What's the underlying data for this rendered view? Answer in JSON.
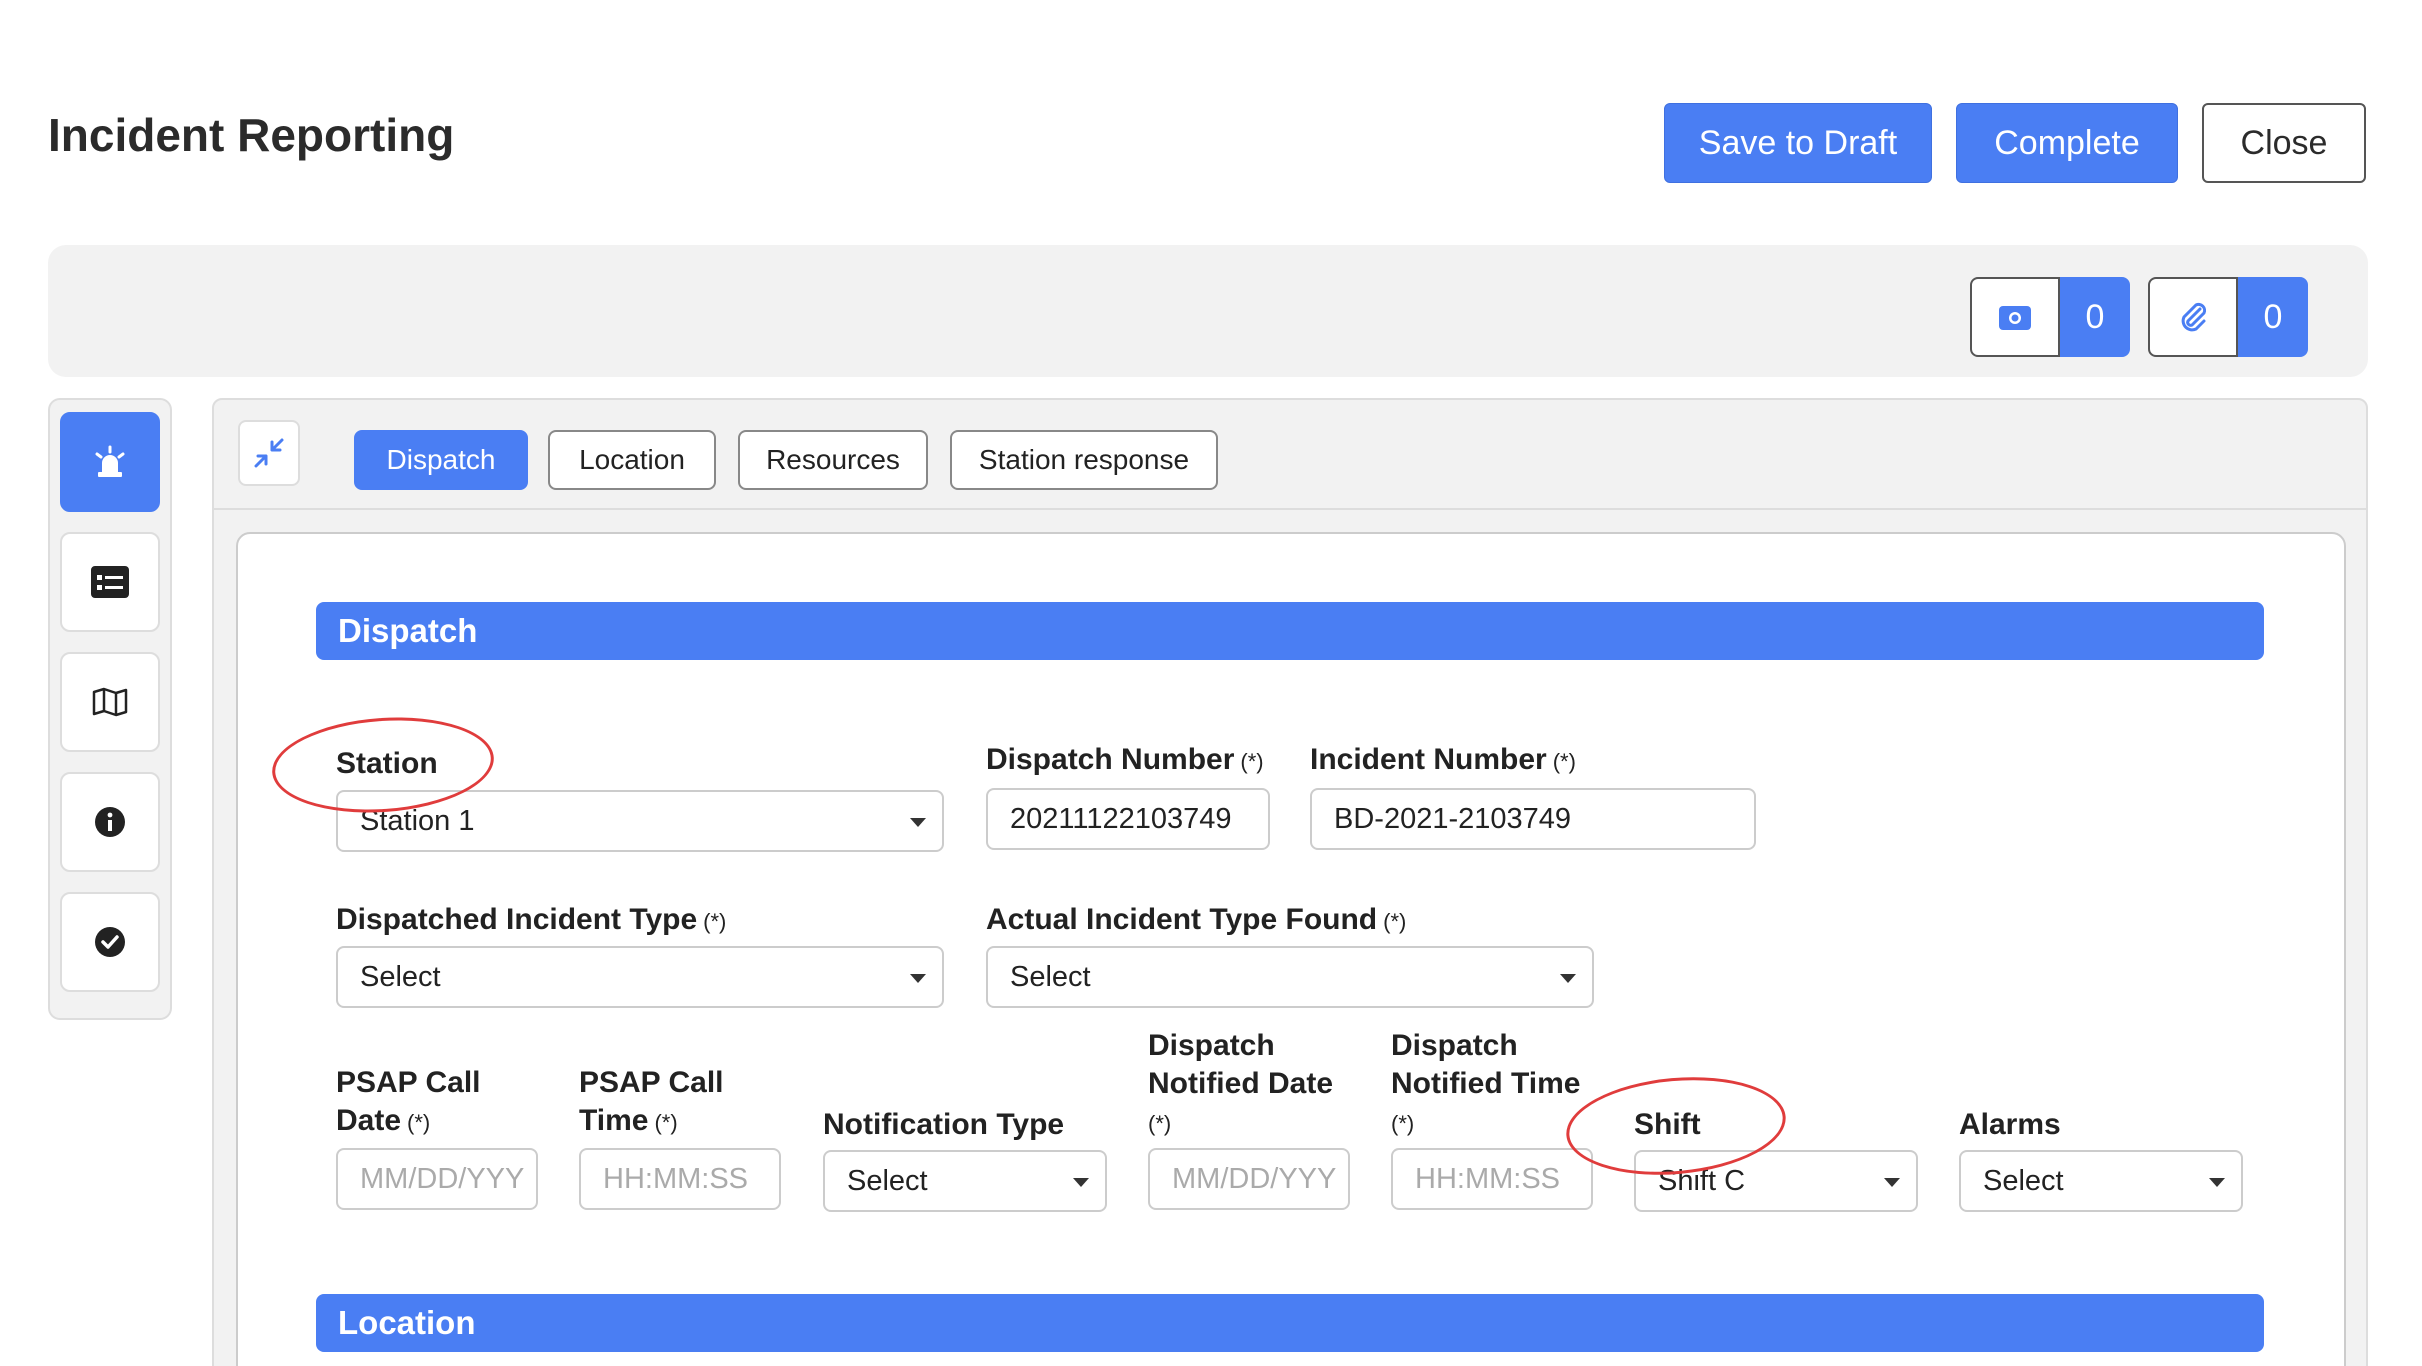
{
  "page": {
    "title": "Incident Reporting"
  },
  "actions": {
    "save_draft": "Save to Draft",
    "complete": "Complete",
    "close": "Close"
  },
  "toolbar": {
    "photos_count": "0",
    "attachments_count": "0"
  },
  "sidebar": {
    "items": [
      "siren-icon",
      "form-card-icon",
      "map-icon",
      "info-icon",
      "check-circle-icon"
    ],
    "active_index": 0
  },
  "tabs": [
    "Dispatch",
    "Location",
    "Resources",
    "Station response"
  ],
  "active_tab": "Dispatch",
  "sections": {
    "dispatch": "Dispatch",
    "location": "Location"
  },
  "form": {
    "required_mark": "(*)",
    "station": {
      "label": "Station",
      "value": "Station 1"
    },
    "dispatch_number": {
      "label": "Dispatch Number",
      "value": "20211122103749"
    },
    "incident_number": {
      "label": "Incident Number",
      "value": "BD-2021-2103749"
    },
    "dispatched_incident_type": {
      "label": "Dispatched Incident Type",
      "value": "Select"
    },
    "actual_incident_type": {
      "label": "Actual Incident Type Found",
      "value": "Select"
    },
    "psap_call_date": {
      "label_line1": "PSAP Call",
      "label_line2": "Date",
      "placeholder": "MM/DD/YYY"
    },
    "psap_call_time": {
      "label_line1": "PSAP Call",
      "label_line2": "Time",
      "placeholder": "HH:MM:SS"
    },
    "notification_type": {
      "label": "Notification Type",
      "value": "Select"
    },
    "dispatch_notified_date": {
      "label_line1": "Dispatch",
      "label_line2": "Notified Date",
      "placeholder": "MM/DD/YYY"
    },
    "dispatch_notified_time": {
      "label_line1": "Dispatch",
      "label_line2": "Notified Time",
      "placeholder": "HH:MM:SS"
    },
    "shift": {
      "label": "Shift",
      "value": "Shift C"
    },
    "alarms": {
      "label": "Alarms",
      "value": "Select"
    }
  },
  "colors": {
    "accent": "#4a7ef3",
    "annotation": "#e03c3c"
  }
}
